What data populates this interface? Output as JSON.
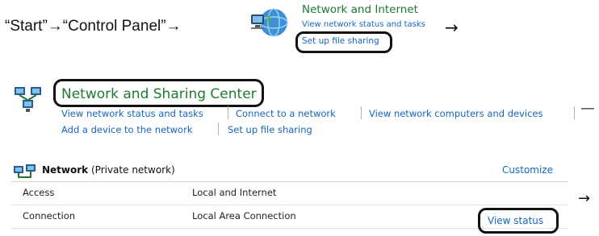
{
  "instruction": {
    "text": "“Start”→“Control Panel”→",
    "arrow_after_links": "→",
    "arrow_after_table": "→"
  },
  "network_internet": {
    "title": "Network and Internet",
    "link_view_status": "View network status and tasks",
    "link_file_sharing": "Set up file sharing"
  },
  "sharing_center": {
    "title": "Network and Sharing Center",
    "links_row1": [
      "View network status and tasks",
      "Connect to a network",
      "View network computers and devices"
    ],
    "links_row2": [
      "Add a device to the network",
      "Set up file sharing"
    ],
    "trailing_dash": "—"
  },
  "network": {
    "name": "Network",
    "type": "(Private network)",
    "customize": "Customize",
    "rows": [
      {
        "label": "Access",
        "value": "Local and Internet"
      },
      {
        "label": "Connection",
        "value": "Local Area Connection"
      }
    ],
    "view_status": "View status"
  },
  "colors": {
    "title_green": "#1e7a2e",
    "link_blue": "#1565c0",
    "highlight_border": "#111111"
  },
  "icons": [
    "network-internet-globe-icon",
    "network-sharing-center-icon",
    "network-icon"
  ]
}
